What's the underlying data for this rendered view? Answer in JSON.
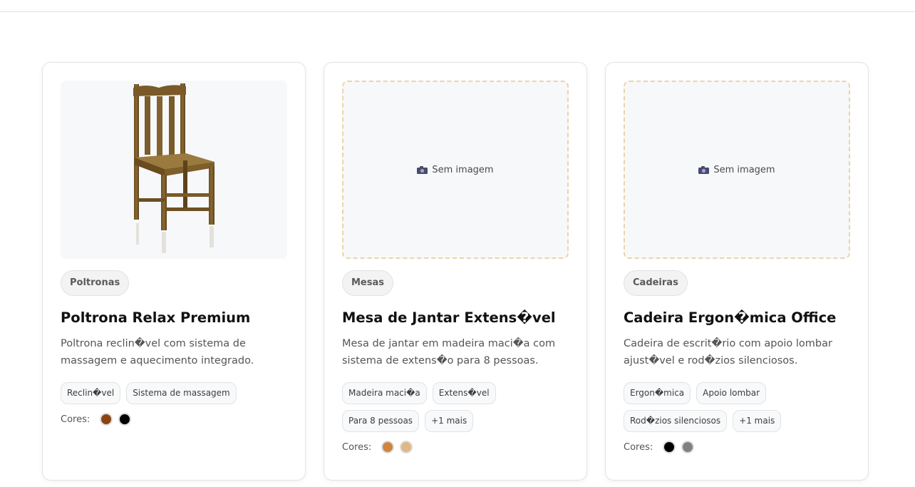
{
  "cards": [
    {
      "image": "chair-photo",
      "category": "Poltronas",
      "title": "Poltrona Relax Premium",
      "description": "Poltrona reclin�vel com sistema de massagem e aquecimento integrado.",
      "tags": [
        "Reclin�vel",
        "Sistema de massagem"
      ],
      "colors_label": "Cores:",
      "colors": [
        "#8b4513",
        "#000000"
      ]
    },
    {
      "image_placeholder": "Sem imagem",
      "category": "Mesas",
      "title": "Mesa de Jantar Extens�vel",
      "description": "Mesa de jantar em madeira maci�a com sistema de extens�o para 8 pessoas.",
      "tags": [
        "Madeira maci�a",
        "Extens�vel",
        "Para 8 pessoas",
        "+1 mais"
      ],
      "colors_label": "Cores:",
      "colors": [
        "#cd853f",
        "#deb887"
      ]
    },
    {
      "image_placeholder": "Sem imagem",
      "category": "Cadeiras",
      "title": "Cadeira Ergon�mica Office",
      "description": "Cadeira de escrit�rio com apoio lombar ajust�vel e rod�zios silenciosos.",
      "tags": [
        "Ergon�mica",
        "Apoio lombar",
        "Rod�zios silenciosos",
        "+1 mais"
      ],
      "colors_label": "Cores:",
      "colors": [
        "#000000",
        "#808080"
      ]
    }
  ]
}
